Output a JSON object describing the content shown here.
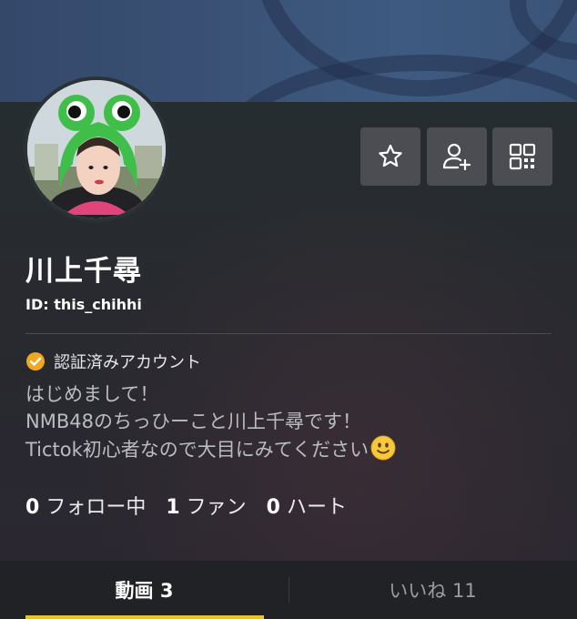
{
  "profile": {
    "name": "川上千尋",
    "id_text": "ID: this_chihhi",
    "verified_label": "認証済みアカウント",
    "bio_lines": [
      "はじめまして！",
      "NMB48のちっひーこと川上千尋です！",
      "Tictok初心者なので大目にみてください"
    ]
  },
  "stats": [
    {
      "value": "0",
      "label": "フォロー中"
    },
    {
      "value": "1",
      "label": "ファン"
    },
    {
      "value": "0",
      "label": "ハート"
    }
  ],
  "actions": {
    "favorite_icon": "star-icon",
    "add_friend_icon": "add-user-icon",
    "qr_icon": "qr-code-icon"
  },
  "tabs": [
    {
      "label": "動画 3",
      "active": true
    },
    {
      "label": "いいね 11",
      "active": false
    }
  ],
  "colors": {
    "verified_badge": "#f0a81f",
    "active_tab_underline": "#e9c22f",
    "banner": "#3a5276"
  }
}
